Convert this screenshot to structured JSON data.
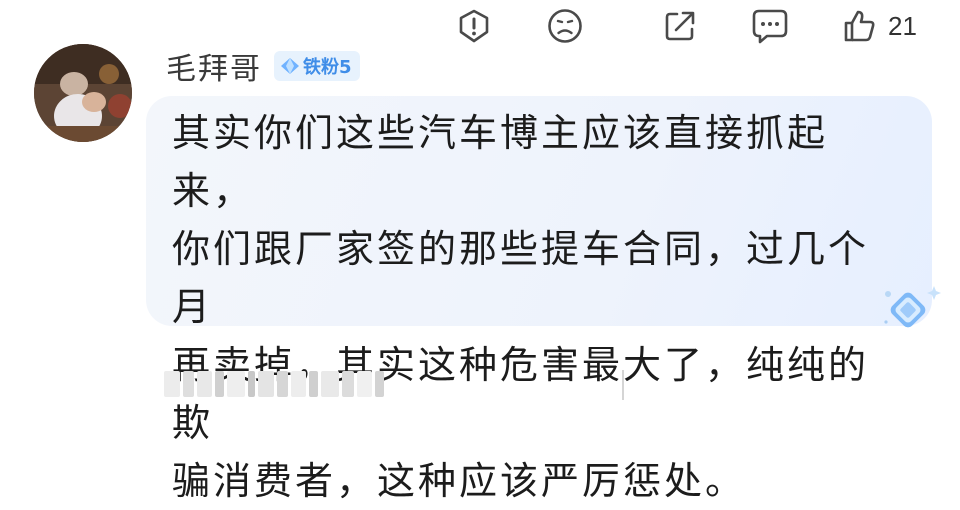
{
  "user": {
    "name": "毛拜哥",
    "badge_label": "铁粉5",
    "badge_icon": "diamond-icon",
    "avatar_icon": "avatar-photo"
  },
  "comment": {
    "text": "其实你们这些汽车博主应该直接抓起来，\n你们跟厂家签的那些提车合同，过几个月\n再卖掉，其实这种危害最大了，纯纯的欺\n骗消费者，这种应该严厉惩处。"
  },
  "actions": [
    {
      "icon": "report-icon"
    },
    {
      "icon": "dislike-face-icon"
    },
    {
      "icon": "share-icon"
    },
    {
      "icon": "reply-comment-icon"
    },
    {
      "icon": "like-thumb-icon",
      "count": "21"
    }
  ],
  "colors": {
    "badge_text": "#3f8de8",
    "badge_bg": "#e7f2fd",
    "bubble_bg": "#eef3fc",
    "icon": "#4a4a4a"
  }
}
